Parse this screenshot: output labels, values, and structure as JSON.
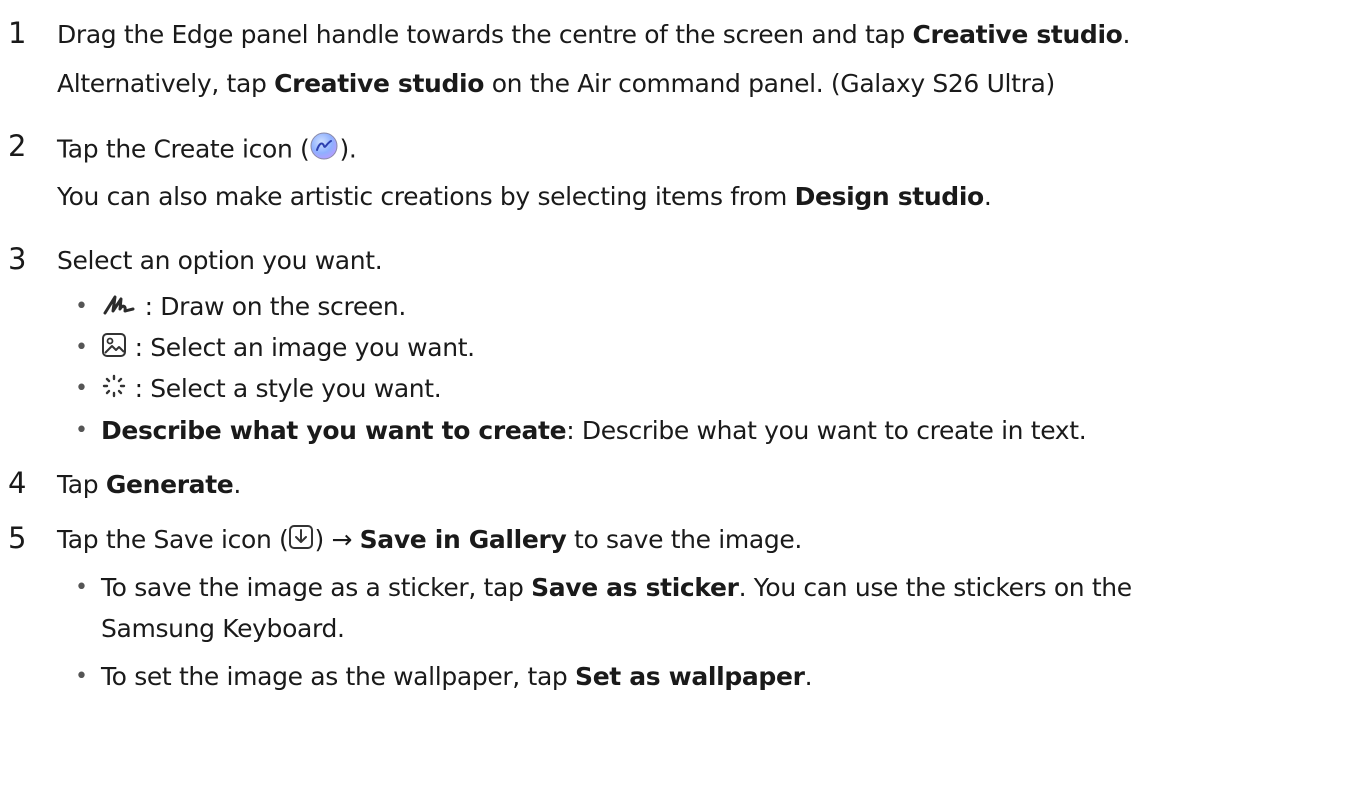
{
  "steps": [
    {
      "number": "1",
      "line1": {
        "text": "Drag the Edge panel handle towards the centre of the screen and tap ",
        "bold": "Creative studio",
        "end": "."
      },
      "line2": {
        "pre": "Alternatively, tap ",
        "bold": "Creative studio",
        "post": " on the Air command panel. (Galaxy S26 Ultra)"
      }
    },
    {
      "number": "2",
      "line1": {
        "pre": "Tap the Create icon (",
        "icon": "create-icon",
        "post": ")."
      },
      "line2": {
        "pre": "You can also make artistic creations by selecting items from ",
        "bold": "Design studio",
        "post": "."
      }
    },
    {
      "number": "3",
      "line1": {
        "text": "Select an option you want."
      },
      "options": [
        {
          "icon": "pen-draw-icon",
          "text": " : Draw on the screen."
        },
        {
          "icon": "image-icon",
          "text": " : Select an image you want."
        },
        {
          "icon": "sparkle-style-icon",
          "text": " : Select a style you want."
        },
        {
          "bold": "Describe what you want to create",
          "text": ": Describe what you want to create in text."
        }
      ]
    },
    {
      "number": "4",
      "line1": {
        "pre": "Tap ",
        "bold": "Generate",
        "post": "."
      }
    },
    {
      "number": "5",
      "line1": {
        "pre": "Tap the Save icon (",
        "icon": "save-download-icon",
        "mid": ") → ",
        "bold": "Save in Gallery",
        "post": " to save the image."
      },
      "options": [
        {
          "pre": "To save the image as a sticker, tap ",
          "bold": "Save as sticker",
          "post": ". You can use the stickers on the",
          "cont": "Samsung Keyboard."
        },
        {
          "pre": "To set the image as the wallpaper, tap ",
          "bold": "Set as wallpaper",
          "post": "."
        }
      ]
    }
  ],
  "bullet_char": "•",
  "colors": {
    "text": "#1a1a1a",
    "create_icon_fill": "#6a8cff",
    "icon_stroke": "#333333"
  }
}
